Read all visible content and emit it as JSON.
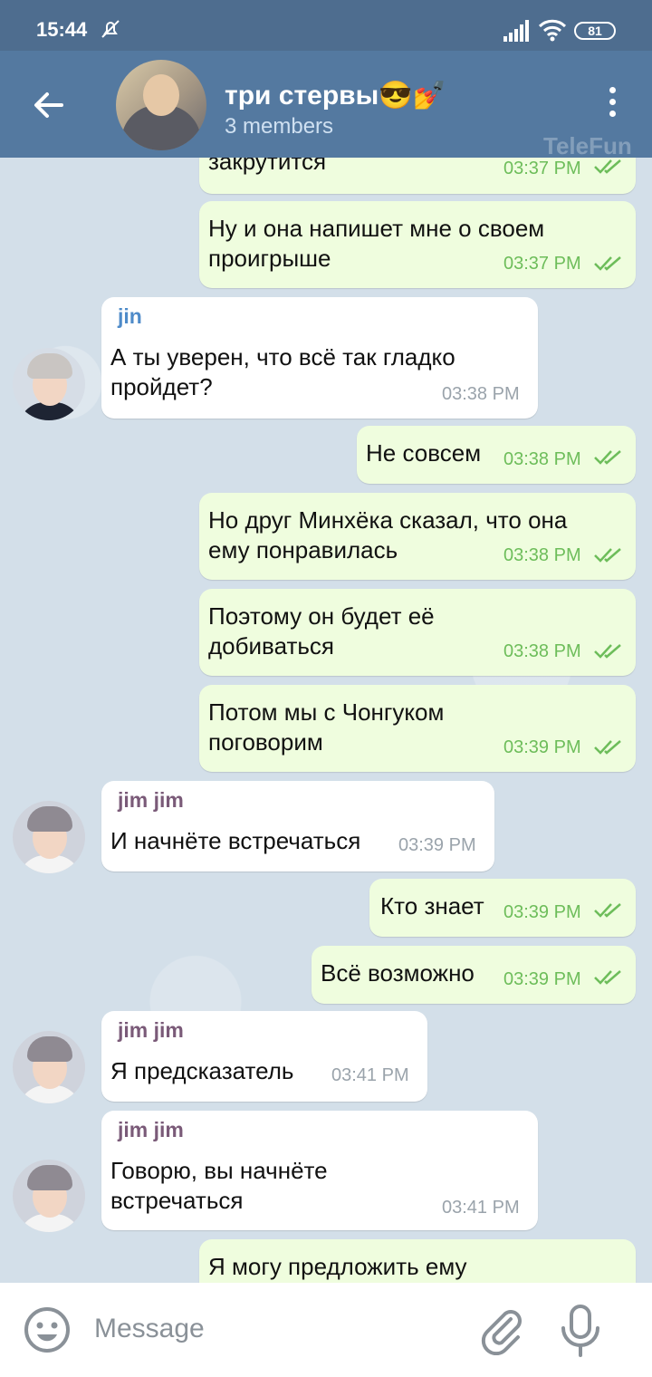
{
  "status": {
    "time": "15:44",
    "battery": "81"
  },
  "header": {
    "title": "три стервы😎💅",
    "subtitle": "3 members",
    "watermark": "TeleFun"
  },
  "messages": [
    {
      "text": "закрутится",
      "time": "03:37 PM"
    },
    {
      "text": "Ну и она напишет мне о своем\nпроигрыше",
      "time": "03:37 PM"
    },
    {
      "sender": "jin",
      "text": "А ты уверен, что всё так гладко\nпройдет?",
      "time": "03:38 PM"
    },
    {
      "text": "Не совсем",
      "time": "03:38 PM"
    },
    {
      "text": "Но друг Минхёка сказал, что она\nему понравилась",
      "time": "03:38 PM"
    },
    {
      "text": "Поэтому он будет её\nдобиваться",
      "time": "03:38 PM"
    },
    {
      "text": "Потом мы с Чонгуком\nпоговорим",
      "time": "03:39 PM"
    },
    {
      "sender": "jim jim",
      "text": "И начнёте встречаться",
      "time": "03:39 PM"
    },
    {
      "text": "Кто знает",
      "time": "03:39 PM"
    },
    {
      "text": "Всё возможно",
      "time": "03:39 PM"
    },
    {
      "sender": "jim jim",
      "text": "Я предсказатель",
      "time": "03:41 PM"
    },
    {
      "sender": "jim jim",
      "text": "Говорю, вы начнёте\nвстречаться",
      "time": "03:41 PM"
    },
    {
      "text": "Я могу предложить ему",
      "time": ""
    }
  ],
  "senders": {
    "jin_color": "#4f8bc9",
    "jim_color": "#7a5a78"
  },
  "composer": {
    "placeholder": "Message"
  },
  "colors": {
    "header": "#5479a0",
    "outgoing": "#effdde",
    "time_out": "#6dbd5a"
  },
  "icons": [
    "back-arrow-icon",
    "more-vert-icon",
    "double-check-icon",
    "emoji-icon",
    "attach-icon",
    "mic-icon",
    "mute-icon",
    "signal-icon",
    "wifi-icon",
    "battery-icon"
  ]
}
